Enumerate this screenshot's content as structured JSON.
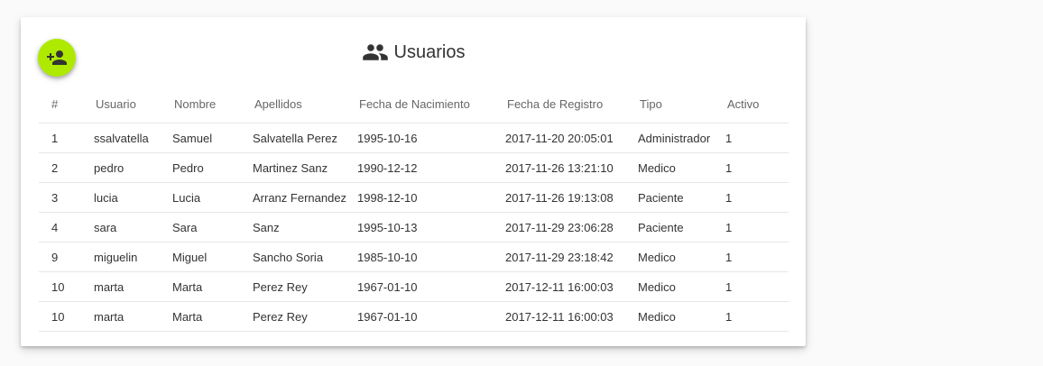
{
  "header": {
    "title": "Usuarios",
    "title_icon": "group-icon",
    "add_button_icon": "person-add-icon",
    "accent_color": "#aeea00"
  },
  "table": {
    "columns": [
      "#",
      "Usuario",
      "Nombre",
      "Apellidos",
      "Fecha de Nacimiento",
      "Fecha de Registro",
      "Tipo",
      "Activo"
    ],
    "rows": [
      [
        "1",
        "ssalvatella",
        "Samuel",
        "Salvatella Perez",
        "1995-10-16",
        "2017-11-20 20:05:01",
        "Administrador",
        "1"
      ],
      [
        "2",
        "pedro",
        "Pedro",
        "Martinez Sanz",
        "1990-12-12",
        "2017-11-26 13:21:10",
        "Medico",
        "1"
      ],
      [
        "3",
        "lucia",
        "Lucia",
        "Arranz Fernandez",
        "1998-12-10",
        "2017-11-26 19:13:08",
        "Paciente",
        "1"
      ],
      [
        "4",
        "sara",
        "Sara",
        "Sanz",
        "1995-10-13",
        "2017-11-29 23:06:28",
        "Paciente",
        "1"
      ],
      [
        "9",
        "miguelin",
        "Miguel",
        "Sancho Soria",
        "1985-10-10",
        "2017-11-29 23:18:42",
        "Medico",
        "1"
      ],
      [
        "10",
        "marta",
        "Marta",
        "Perez Rey",
        "1967-01-10",
        "2017-12-11 16:00:03",
        "Medico",
        "1"
      ],
      [
        "10",
        "marta",
        "Marta",
        "Perez Rey",
        "1967-01-10",
        "2017-12-11 16:00:03",
        "Medico",
        "1"
      ]
    ]
  }
}
